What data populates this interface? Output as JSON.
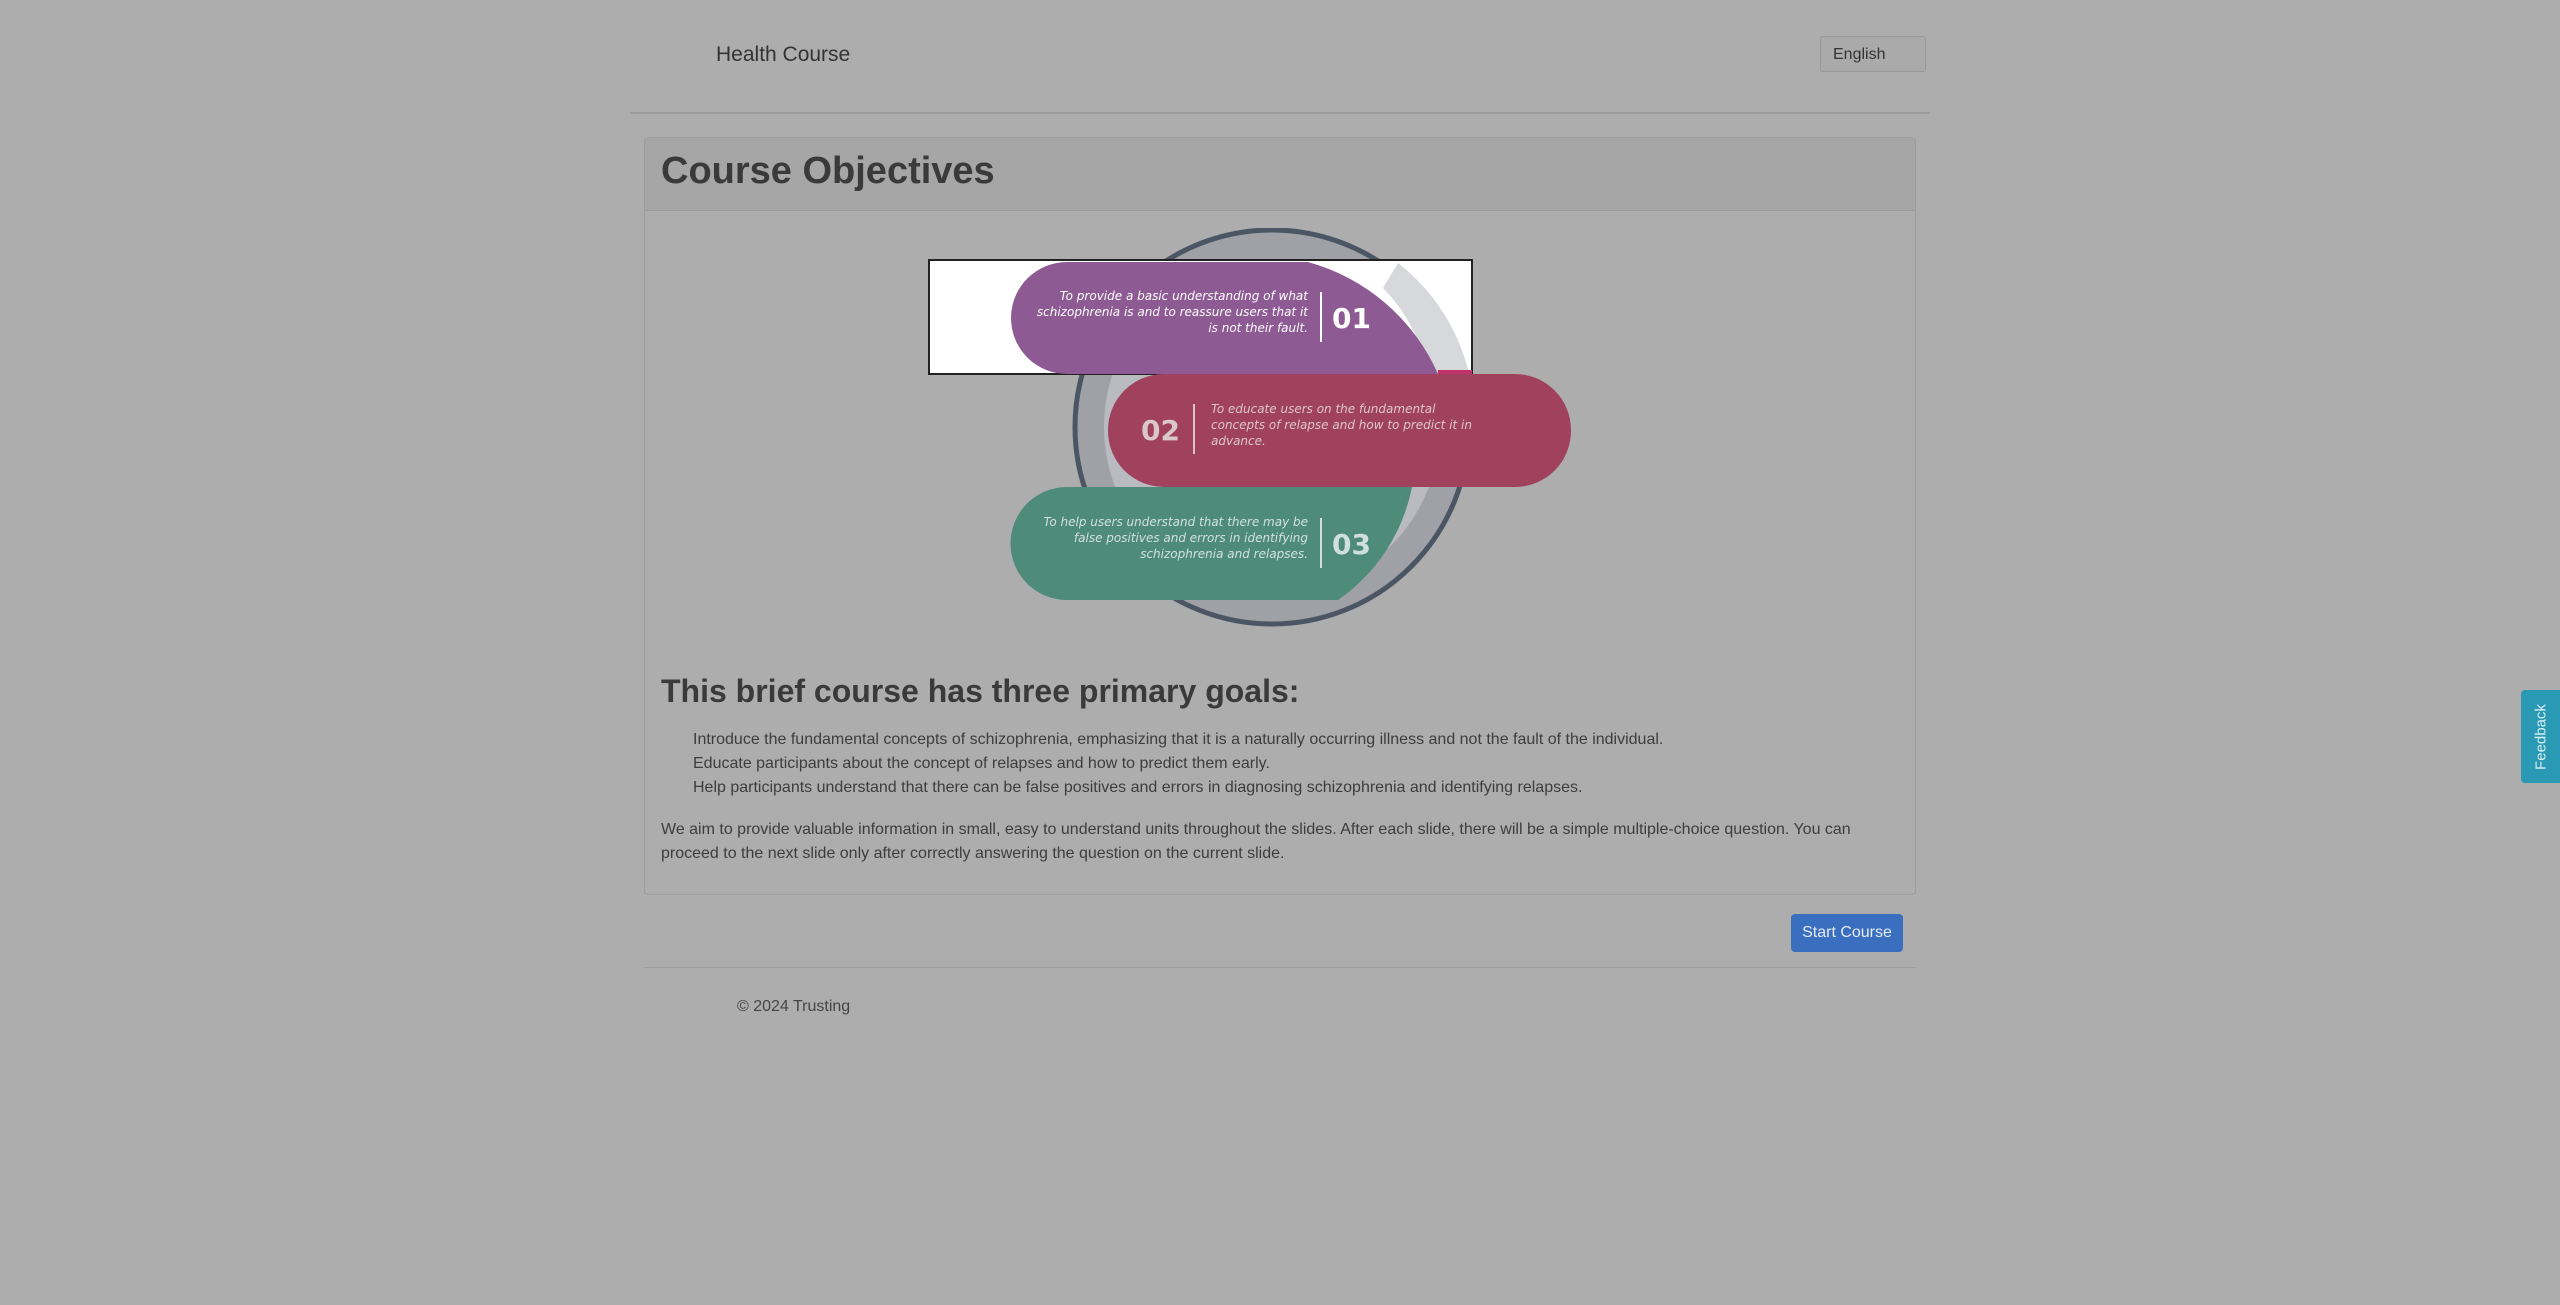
{
  "header": {
    "brand": "Health Course",
    "language": "English"
  },
  "card": {
    "title": "Course Objectives"
  },
  "diagram": {
    "items": [
      {
        "number": "01",
        "text_lines": [
          "To provide a basic understanding of what",
          "schizophrenia is and to reassure users that it",
          "is not their fault."
        ],
        "color": "#8e5a94"
      },
      {
        "number": "02",
        "text_lines": [
          "To educate users on the fundamental",
          "concepts of relapse and how to predict it in",
          "advance."
        ],
        "color": "#a0425e"
      },
      {
        "number": "03",
        "text_lines": [
          "To help users understand that there may be",
          "false positives and errors in identifying",
          "schizophrenia and relapses."
        ],
        "color": "#4e8b79"
      }
    ]
  },
  "goals": {
    "title": "This brief course has three primary goals:",
    "items": [
      "Introduce the fundamental concepts of schizophrenia, emphasizing that it is a naturally occurring illness and not the fault of the individual.",
      "Educate participants about the concept of relapses and how to predict them early.",
      "Help participants understand that there can be false positives and errors in diagnosing schizophrenia and identifying relapses."
    ],
    "intro": "We aim to provide valuable information in small, easy to understand units throughout the slides. After each slide, there will be a simple multiple-choice question. You can proceed to the next slide only after correctly answering the question on the current slide."
  },
  "actions": {
    "start": "Start Course"
  },
  "footer": {
    "copyright": "© 2024 Trusting"
  },
  "feedback": {
    "label": "Feedback"
  },
  "colors": {
    "background": "#adadad",
    "primary_button": "#3a6fbf",
    "feedback_tab": "#2a9ab4"
  }
}
